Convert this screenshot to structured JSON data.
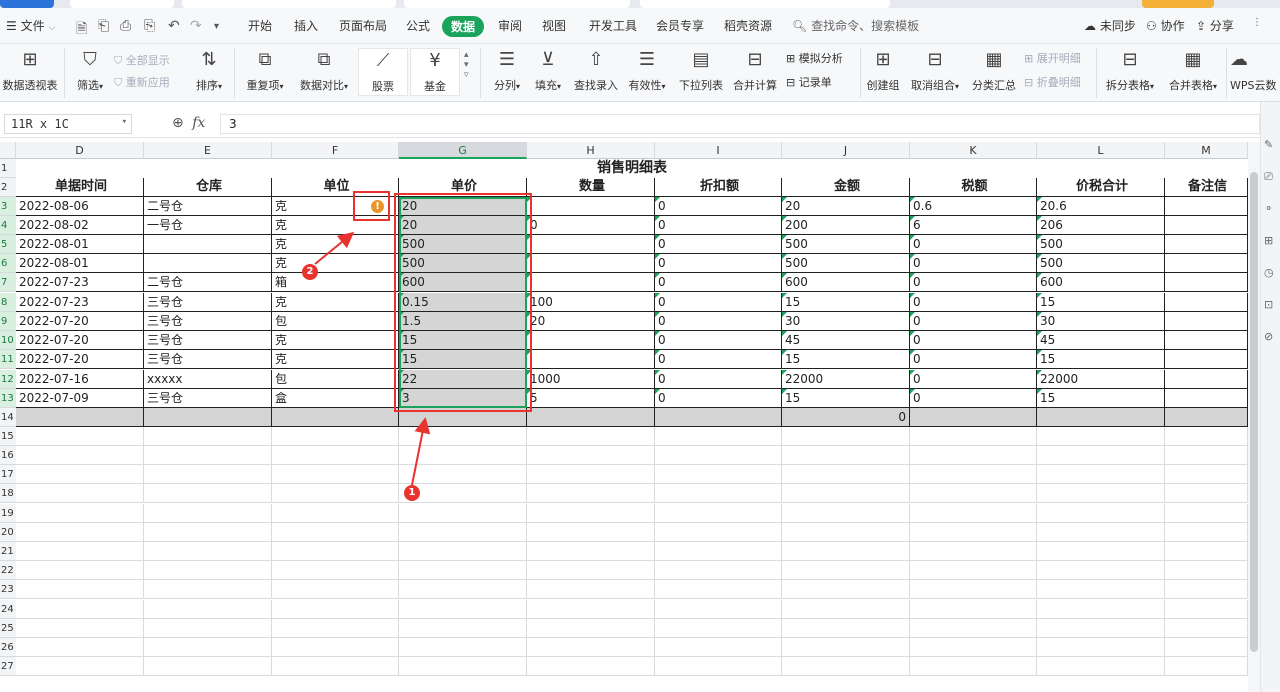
{
  "menubar": {
    "hamburger_icon": "menu-icon",
    "file": "文件",
    "tabs": [
      "开始",
      "插入",
      "页面布局",
      "公式",
      "数据",
      "审阅",
      "视图",
      "开发工具",
      "会员专享",
      "稻壳资源"
    ],
    "active_tab": "数据",
    "search_placeholder": "查找命令、搜索模板",
    "sync": "未同步",
    "collab": "协作",
    "share": "分享"
  },
  "ribbon": {
    "pivot": "数据透视表",
    "filter": "筛选",
    "show_all": "全部显示",
    "reapply": "重新应用",
    "sort": "排序",
    "duplicates": "重复项",
    "compare": "数据对比",
    "stock": "股票",
    "fund": "基金",
    "split": "分列",
    "fill": "填充",
    "lookup": "查找录入",
    "validity": "有效性",
    "dropdown": "下拉列表",
    "merge_calc": "合并计算",
    "simulate": "模拟分析",
    "record": "记录单",
    "group": "创建组",
    "ungroup": "取消组合",
    "subtotal": "分类汇总",
    "expand": "展开明细",
    "collapse": "折叠明细",
    "split_table": "拆分表格",
    "merge_table": "合并表格",
    "wps_cloud": "WPS云数"
  },
  "formula": {
    "namebox": "11R x 1C",
    "fx": "fx",
    "value": "3"
  },
  "sheet": {
    "columns": [
      "D",
      "E",
      "F",
      "G",
      "H",
      "I",
      "J",
      "K",
      "L",
      "M"
    ],
    "selected_column": "G",
    "title": "销售明细表",
    "headers": [
      "单据时间",
      "仓库",
      "单位",
      "单价",
      "数量",
      "折扣额",
      "金额",
      "税额",
      "价税合计",
      "备注信"
    ],
    "rows": [
      [
        "2022-08-06",
        "二号仓",
        "克",
        "20",
        "",
        "0",
        "20",
        "0.6",
        "20.6",
        ""
      ],
      [
        "2022-08-02",
        "一号仓",
        "克",
        "20",
        "0",
        "0",
        "200",
        "6",
        "206",
        ""
      ],
      [
        "2022-08-01",
        "",
        "克",
        "500",
        "",
        "0",
        "500",
        "0",
        "500",
        ""
      ],
      [
        "2022-08-01",
        "",
        "克",
        "500",
        "",
        "0",
        "500",
        "0",
        "500",
        ""
      ],
      [
        "2022-07-23",
        "二号仓",
        "箱",
        "600",
        "",
        "0",
        "600",
        "0",
        "600",
        ""
      ],
      [
        "2022-07-23",
        "三号仓",
        "克",
        "0.15",
        "100",
        "0",
        "15",
        "0",
        "15",
        ""
      ],
      [
        "2022-07-20",
        "三号仓",
        "包",
        "1.5",
        "20",
        "0",
        "30",
        "0",
        "30",
        ""
      ],
      [
        "2022-07-20",
        "三号仓",
        "克",
        "15",
        "",
        "0",
        "45",
        "0",
        "45",
        ""
      ],
      [
        "2022-07-20",
        "三号仓",
        "克",
        "15",
        "",
        "0",
        "15",
        "0",
        "15",
        ""
      ],
      [
        "2022-07-16",
        "xxxxx",
        "包",
        "22",
        "1000",
        "0",
        "22000",
        "0",
        "22000",
        ""
      ],
      [
        "2022-07-09",
        "三号仓",
        "盒",
        "3",
        "5",
        "0",
        "15",
        "0",
        "15",
        ""
      ]
    ],
    "total_value": "0",
    "row_numbers": [
      "1",
      "2",
      "3",
      "4",
      "5",
      "6",
      "7",
      "8",
      "9",
      "10",
      "11",
      "12",
      "13",
      "14",
      "15",
      "16",
      "17",
      "18",
      "19",
      "20",
      "21",
      "22",
      "23",
      "24",
      "25",
      "26",
      "27"
    ]
  },
  "annotations": {
    "badge1": "1",
    "badge2": "2",
    "warning_symbol": "!"
  },
  "colors": {
    "accent": "#1aa35a",
    "annotation": "#e8332f",
    "warning": "#e8962a",
    "selection_fill": "#d5d5d5"
  }
}
